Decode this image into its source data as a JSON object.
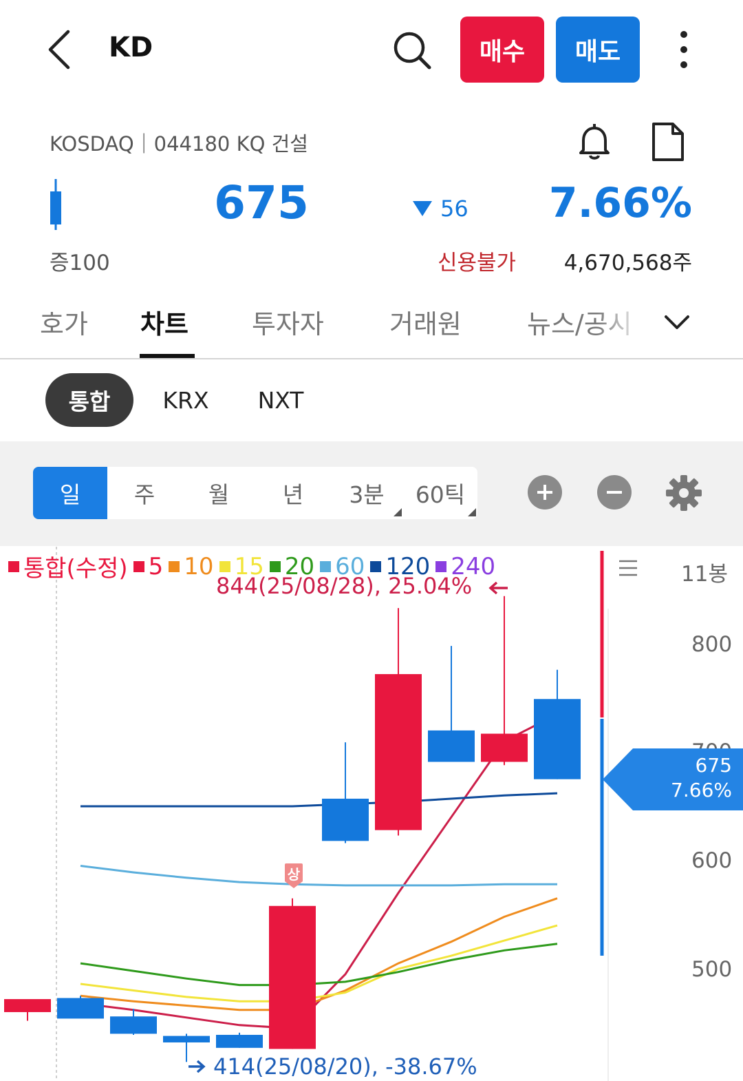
{
  "header": {
    "title": "KD",
    "buy_label": "매수",
    "sell_label": "매도"
  },
  "stock": {
    "market_line": "KOSDAQ｜044180 KQ 건설",
    "price": "675",
    "change": "56",
    "change_direction": "down",
    "change_pct": "7.66%",
    "margin": "증100",
    "credit": "신용불가",
    "volume": "4,670,568주"
  },
  "tabs": [
    {
      "label": "호가"
    },
    {
      "label": "차트"
    },
    {
      "label": "투자자"
    },
    {
      "label": "거래원"
    },
    {
      "label": "뉴스/공시"
    }
  ],
  "active_tab": 1,
  "exchanges": [
    {
      "label": "통합"
    },
    {
      "label": "KRX"
    },
    {
      "label": "NXT"
    }
  ],
  "periods": [
    {
      "label": "일"
    },
    {
      "label": "주"
    },
    {
      "label": "월"
    },
    {
      "label": "년"
    },
    {
      "label": "3분"
    },
    {
      "label": "60틱"
    }
  ],
  "icons": {
    "back": "chevron-left-icon",
    "search": "search-icon",
    "more": "more-vertical-icon",
    "bell": "bell-icon",
    "doc": "document-icon",
    "zoom_in": "plus-circle-icon",
    "zoom_out": "minus-circle-icon",
    "settings": "gear-icon",
    "menu": "hamburger-icon"
  },
  "colors": {
    "up": "#e8173f",
    "down": "#1478dc",
    "ma5": "#cc1f4a",
    "ma10": "#ef8c1e",
    "ma15": "#f2e43a",
    "ma20": "#2e9a1b",
    "ma60": "#5aaedc",
    "ma120": "#0d4a9a",
    "ma240": "#8a3ee0"
  },
  "chart_data": {
    "type": "candlestick",
    "bong_label": "11봉",
    "legend": [
      {
        "name": "통합(수정)",
        "color": "#e8173f"
      },
      {
        "name": "5",
        "color": "#e8173f"
      },
      {
        "name": "10",
        "color": "#ef8c1e"
      },
      {
        "name": "15",
        "color": "#f2e43a"
      },
      {
        "name": "20",
        "color": "#2e9a1b"
      },
      {
        "name": "60",
        "color": "#5aaedc"
      },
      {
        "name": "120",
        "color": "#0d4a9a"
      },
      {
        "name": "240",
        "color": "#8a3ee0"
      }
    ],
    "y_ticks": [
      "800",
      "700",
      "600",
      "500"
    ],
    "ylim": [
      415,
      860
    ],
    "candles": [
      {
        "open": 460,
        "high": 462,
        "low": 452,
        "close": 472
      },
      {
        "open": 473,
        "high": 475,
        "low": 455,
        "close": 454
      },
      {
        "open": 456,
        "high": 463,
        "low": 439,
        "close": 440
      },
      {
        "open": 438,
        "high": 440,
        "low": 414,
        "close": 432
      },
      {
        "open": 439,
        "high": 441,
        "low": 427,
        "close": 427
      },
      {
        "open": 426,
        "high": 565,
        "low": 426,
        "close": 558
      },
      {
        "open": 657,
        "high": 709,
        "low": 616,
        "close": 618
      },
      {
        "open": 628,
        "high": 833,
        "low": 623,
        "close": 772
      },
      {
        "open": 720,
        "high": 798,
        "low": 708,
        "close": 691
      },
      {
        "open": 691,
        "high": 844,
        "low": 688,
        "close": 717
      },
      {
        "open": 749,
        "high": 776,
        "low": 675,
        "close": 675
      }
    ],
    "moving_averages": [
      {
        "name": "5",
        "color": "#cc1f4a",
        "values": [
          null,
          468,
          462,
          455,
          448,
          445,
          495,
          570,
          640,
          710,
          735
        ]
      },
      {
        "name": "10",
        "color": "#ef8c1e",
        "values": [
          null,
          475,
          470,
          466,
          462,
          462,
          480,
          505,
          525,
          548,
          565
        ]
      },
      {
        "name": "15",
        "color": "#f2e43a",
        "values": [
          null,
          486,
          480,
          474,
          470,
          470,
          478,
          500,
          512,
          526,
          540
        ]
      },
      {
        "name": "20",
        "color": "#2e9a1b",
        "values": [
          null,
          505,
          498,
          491,
          485,
          485,
          488,
          497,
          508,
          517,
          523
        ]
      },
      {
        "name": "60",
        "color": "#5aaedc",
        "values": [
          null,
          595,
          589,
          584,
          580,
          578,
          577,
          577,
          577,
          578,
          578
        ]
      },
      {
        "name": "120",
        "color": "#0d4a9a",
        "values": [
          null,
          650,
          650,
          650,
          650,
          650,
          652,
          654,
          657,
          660,
          662
        ]
      }
    ],
    "high_annotation": "844(25/08/28), 25.04%",
    "low_annotation": "414(25/08/20), -38.67%",
    "upper_limit_badge": "상",
    "current_price_label": "675",
    "current_pct_label": "7.66%"
  }
}
